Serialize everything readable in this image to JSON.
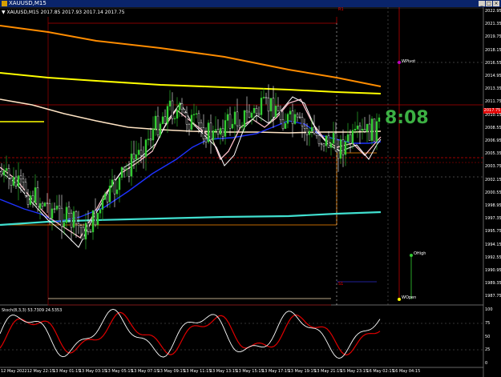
{
  "window": {
    "title": "XAUUSD,M15",
    "min_label": "_",
    "max_label": "□",
    "close_label": "×"
  },
  "chart": {
    "symbol_header": "▼ XAUUSD,M15  2017.85 2017.93 2017.14 2017.75",
    "timer": "8:08",
    "current_price": "2017.75",
    "stoch_header": "Stoch(8,3,3) 53.7309 24.5353",
    "labels": {
      "wpivot": "WPivot",
      "ohigh": "OHigh",
      "wopen": "WOpen",
      "s1": "S1",
      "r1": "R1"
    },
    "price_scale": [
      "2022.95",
      "2021.35",
      "2019.75",
      "2018.15",
      "2016.55",
      "2014.95",
      "2013.35",
      "2011.75",
      "2010.15",
      "2008.55",
      "2006.95",
      "2005.35",
      "2003.75",
      "2002.15",
      "2000.55",
      "1998.95",
      "1997.35",
      "1995.75",
      "1994.15",
      "1992.55",
      "1990.95",
      "1989.35",
      "1987.75"
    ],
    "stoch_scale": [
      "100",
      "75",
      "50",
      "25",
      "0"
    ],
    "time_axis": [
      "12 May 2022",
      "12 May 22:15",
      "13 May 01:15",
      "13 May 03:15",
      "13 May 05:15",
      "13 May 07:15",
      "13 May 09:15",
      "13 May 11:15",
      "13 May 13:15",
      "13 May 15:15",
      "13 May 17:15",
      "13 May 19:15",
      "13 May 21:15",
      "15 May 23:15",
      "16 May 02:15",
      "16 May 04:15"
    ]
  },
  "colors": {
    "bull": "#32cd32",
    "bear": "#ffffff",
    "ma_orange": "#ff8c00",
    "ma_yellow": "#ffff00",
    "ma_cream": "#ffe4c4",
    "ma_pink": "#ffc0cb",
    "ma_blue": "#1e32ff",
    "ma_cyan": "#40e0d0",
    "stoch_main": "#ffffff",
    "stoch_signal": "#e00000",
    "pivot_red": "#b00000"
  }
}
